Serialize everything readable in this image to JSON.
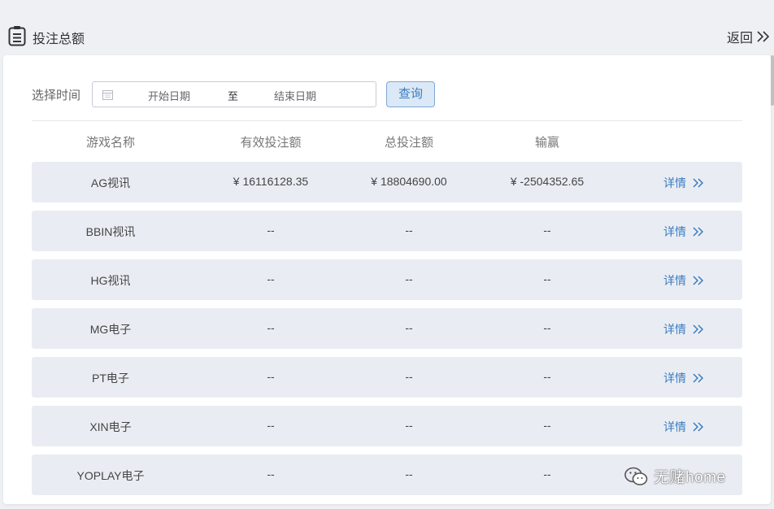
{
  "header": {
    "title": "投注总额",
    "back_label": "返回"
  },
  "filter": {
    "label": "选择时间",
    "start_placeholder": "开始日期",
    "separator": "至",
    "end_placeholder": "结束日期",
    "query_label": "查询"
  },
  "table": {
    "columns": [
      "游戏名称",
      "有效投注额",
      "总投注额",
      "输赢"
    ],
    "detail_label": "详情",
    "rows": [
      {
        "name": "AG视讯",
        "valid": "¥ 16116128.35",
        "total": "¥ 18804690.00",
        "win": "¥ -2504352.65"
      },
      {
        "name": "BBIN视讯",
        "valid": "--",
        "total": "--",
        "win": "--"
      },
      {
        "name": "HG视讯",
        "valid": "--",
        "total": "--",
        "win": "--"
      },
      {
        "name": "MG电子",
        "valid": "--",
        "total": "--",
        "win": "--"
      },
      {
        "name": "PT电子",
        "valid": "--",
        "total": "--",
        "win": "--"
      },
      {
        "name": "XIN电子",
        "valid": "--",
        "total": "--",
        "win": "--"
      },
      {
        "name": "YOPLAY电子",
        "valid": "--",
        "total": "--",
        "win": "--"
      }
    ]
  },
  "watermark": {
    "text": "无赌home"
  },
  "colors": {
    "accent": "#3c7cc0",
    "row_bg": "#e9edf3",
    "page_bg": "#eef0f3"
  },
  "icons": [
    "clipboard-icon",
    "double-chevron-right-icon",
    "calendar-icon",
    "wechat-icon"
  ]
}
